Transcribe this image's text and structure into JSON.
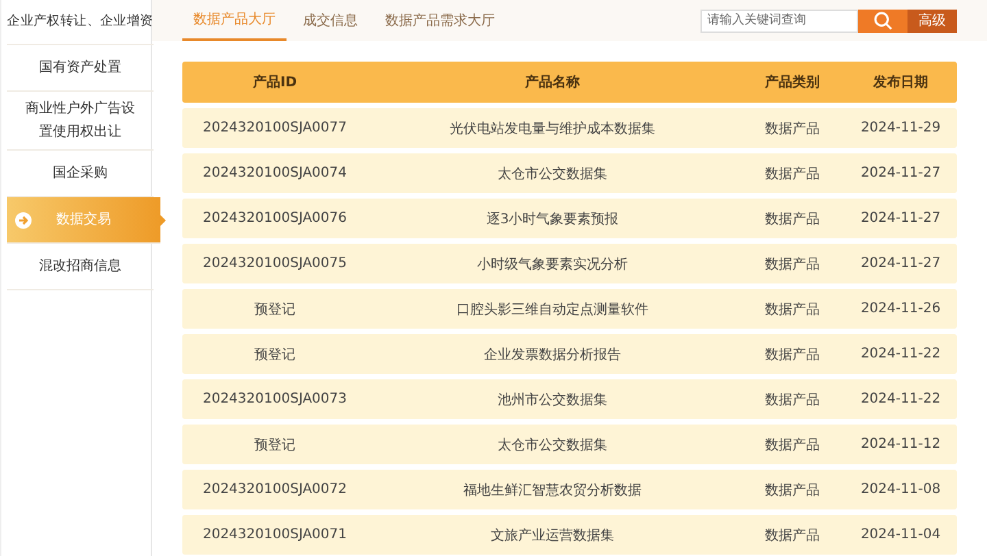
{
  "sidebar": {
    "items": [
      {
        "label": "企业产权转让、企业增资",
        "selected": false
      },
      {
        "label": "国有资产处置",
        "selected": false
      },
      {
        "label": "商业性户外广告设置使用权出让",
        "selected": false
      },
      {
        "label": "国企采购",
        "selected": false
      },
      {
        "label": "数据交易",
        "selected": true
      },
      {
        "label": "混改招商信息",
        "selected": false
      }
    ]
  },
  "tabs": [
    {
      "label": "数据产品大厅",
      "selected": true
    },
    {
      "label": "成交信息",
      "selected": false
    },
    {
      "label": "数据产品需求大厅",
      "selected": false
    }
  ],
  "search": {
    "placeholder": "请输入关键词查询",
    "advanced": "高级"
  },
  "table": {
    "columns": [
      "产品ID",
      "产品名称",
      "产品类别",
      "发布日期"
    ],
    "rows": [
      [
        "2024320100SJA0077",
        "光伏电站发电量与维护成本数据集",
        "数据产品",
        "2024-11-29"
      ],
      [
        "2024320100SJA0074",
        "太仓市公交数据集",
        "数据产品",
        "2024-11-27"
      ],
      [
        "2024320100SJA0076",
        "逐3小时气象要素预报",
        "数据产品",
        "2024-11-27"
      ],
      [
        "2024320100SJA0075",
        "小时级气象要素实况分析",
        "数据产品",
        "2024-11-27"
      ],
      [
        "预登记",
        "口腔头影三维自动定点测量软件",
        "数据产品",
        "2024-11-26"
      ],
      [
        "预登记",
        "企业发票数据分析报告",
        "数据产品",
        "2024-11-22"
      ],
      [
        "2024320100SJA0073",
        "池州市公交数据集",
        "数据产品",
        "2024-11-22"
      ],
      [
        "预登记",
        "太仓市公交数据集",
        "数据产品",
        "2024-11-12"
      ],
      [
        "2024320100SJA0072",
        "福地生鲜汇智慧农贸分析数据",
        "数据产品",
        "2024-11-08"
      ],
      [
        "2024320100SJA0071",
        "文旅产业运营数据集",
        "数据产品",
        "2024-11-04"
      ]
    ]
  }
}
